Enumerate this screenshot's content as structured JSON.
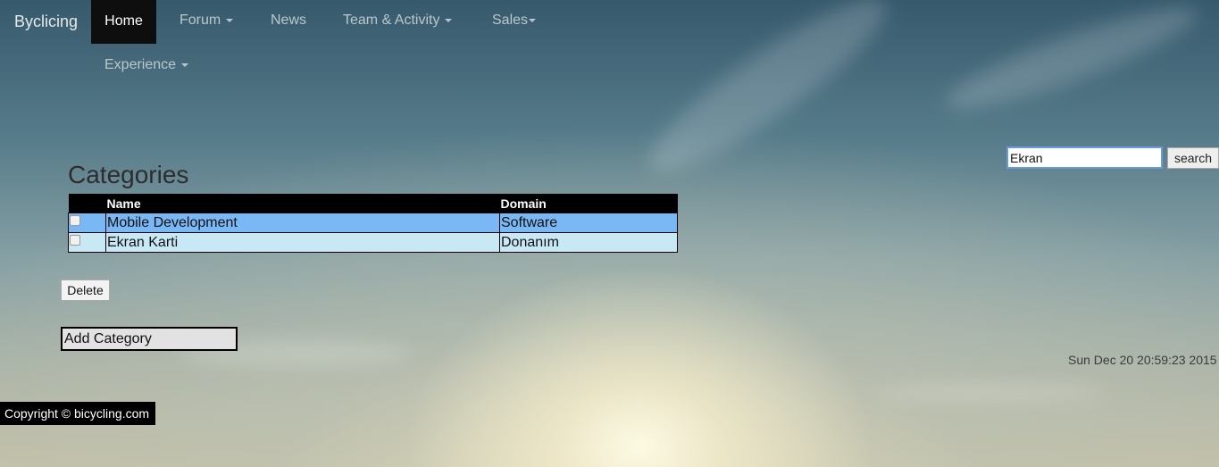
{
  "navbar": {
    "brand": "Byclicing",
    "items": [
      {
        "label": "Home"
      },
      {
        "label": "Forum"
      },
      {
        "label": "News"
      },
      {
        "label": "Team & Activity"
      },
      {
        "label": "Sales"
      },
      {
        "label": "Experience"
      }
    ]
  },
  "main": {
    "title": "Categories",
    "table": {
      "headers": [
        "",
        "Name",
        "Domain"
      ],
      "rows": [
        {
          "name": "Mobile Development",
          "domain": "Software"
        },
        {
          "name": "Ekran Karti",
          "domain": "Donanım"
        }
      ]
    },
    "delete_label": "Delete",
    "add_label": "Add Category"
  },
  "search": {
    "value": "Ekran",
    "button_label": "search"
  },
  "datetime": "Sun Dec 20 20:59:23 2015",
  "footer": {
    "copyright": "Copyright © bicycling.com"
  },
  "colors": {
    "nav_active_bg": "#0e0e0e",
    "table_header_bg": "#000000",
    "row_a_bg": "#7ab8f5",
    "row_b_bg": "#c8e8f6"
  }
}
